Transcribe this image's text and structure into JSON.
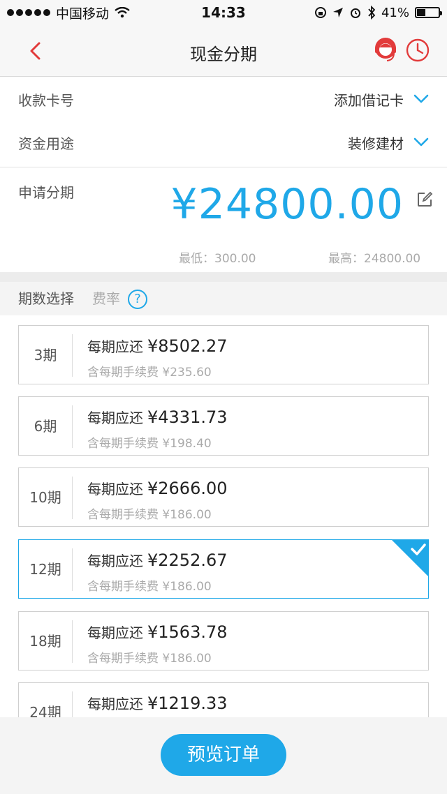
{
  "status_bar": {
    "carrier": "中国移动",
    "time": "14:33",
    "battery": "41%",
    "battery_level": 0.41
  },
  "nav": {
    "title": "现金分期",
    "back_icon": "chevron-left-icon",
    "service_icon": "customer-service-icon",
    "history_icon": "clock-icon",
    "accent_color": "#e23b3b"
  },
  "form": {
    "card_label": "收款卡号",
    "card_value": "添加借记卡",
    "purpose_label": "资金用途",
    "purpose_value": "装修建材",
    "apply_label": "申请分期",
    "amount": "¥24800.00",
    "min_text": "最低：300.00",
    "max_text": "最高：24800.00"
  },
  "terms": {
    "header_label": "期数选择",
    "rate_label": "费率",
    "help_symbol": "?",
    "options": [
      {
        "term": "3期",
        "pay_label": "每期应还",
        "pay": "¥8502.27",
        "fee_text": "含每期手续费 ¥235.60",
        "selected": false
      },
      {
        "term": "6期",
        "pay_label": "每期应还",
        "pay": "¥4331.73",
        "fee_text": "含每期手续费 ¥198.40",
        "selected": false
      },
      {
        "term": "10期",
        "pay_label": "每期应还",
        "pay": "¥2666.00",
        "fee_text": "含每期手续费 ¥186.00",
        "selected": false
      },
      {
        "term": "12期",
        "pay_label": "每期应还",
        "pay": "¥2252.67",
        "fee_text": "含每期手续费 ¥186.00",
        "selected": true
      },
      {
        "term": "18期",
        "pay_label": "每期应还",
        "pay": "¥1563.78",
        "fee_text": "含每期手续费 ¥186.00",
        "selected": false
      },
      {
        "term": "24期",
        "pay_label": "每期应还",
        "pay": "¥1219.33",
        "fee_text": "",
        "selected": false
      }
    ]
  },
  "footer": {
    "preview_label": "预览订单"
  },
  "colors": {
    "primary": "#1fa8e8",
    "accent_red": "#e23b3b"
  }
}
